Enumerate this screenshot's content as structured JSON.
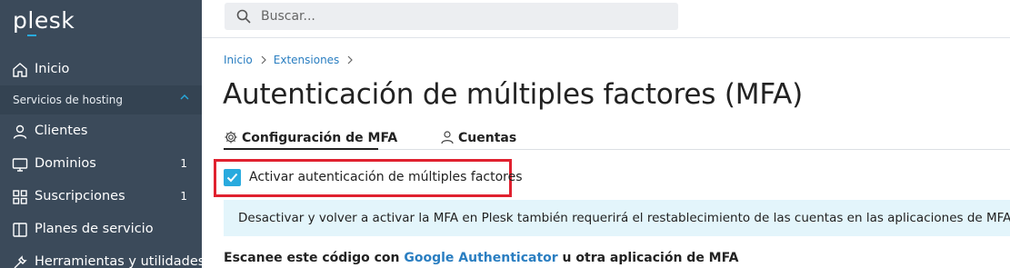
{
  "sidebar": {
    "logo": "plesk",
    "home": "Inicio",
    "group": "Servicios de hosting",
    "items": [
      {
        "label": "Clientes",
        "icon": "user-icon",
        "count": ""
      },
      {
        "label": "Dominios",
        "icon": "monitor-icon",
        "count": "1"
      },
      {
        "label": "Suscripciones",
        "icon": "grid-icon",
        "count": "1"
      },
      {
        "label": "Planes de servicio",
        "icon": "book-icon",
        "count": ""
      },
      {
        "label": "Herramientas y utilidades",
        "icon": "tools-icon",
        "count": ""
      }
    ]
  },
  "search": {
    "placeholder": "Buscar..."
  },
  "breadcrumb": [
    "Inicio",
    "Extensiones"
  ],
  "page": {
    "title": "Autenticación de múltiples factores (MFA)"
  },
  "tabs": [
    {
      "label": "Configuración de MFA",
      "icon": "gear-icon",
      "active": true
    },
    {
      "label": "Cuentas",
      "icon": "user-icon",
      "active": false
    }
  ],
  "mfa": {
    "checkbox_label": "Activar autenticación de múltiples factores",
    "checked": true,
    "info": "Desactivar y volver a activar la MFA en Plesk también requerirá el restablecimiento de las cuentas en las aplicaciones de MFA.",
    "scan_prefix": "Escanee este código con ",
    "scan_link": "Google Authenticator",
    "scan_suffix": " u otra aplicación de MFA"
  },
  "colors": {
    "sidebar": "#3b4a5a",
    "accent": "#28aade",
    "link": "#2a7ec1",
    "highlight": "#e0212f",
    "info_bg": "#e3f5fb"
  }
}
